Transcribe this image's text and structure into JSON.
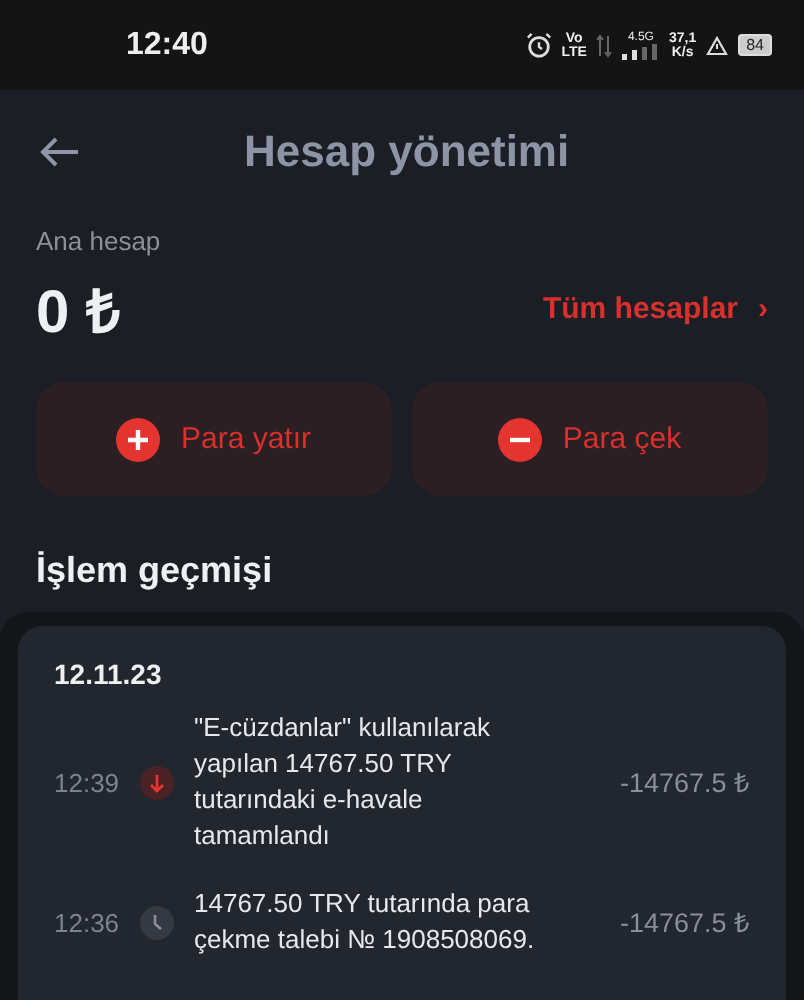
{
  "status_bar": {
    "time": "12:40",
    "volte_top": "Vo",
    "volte_bottom": "LTE",
    "network": "4.5G",
    "speed_value": "37,1",
    "speed_unit": "K/s",
    "battery": "84"
  },
  "header": {
    "title": "Hesap yönetimi"
  },
  "account": {
    "label": "Ana hesap",
    "balance": "0 ₺",
    "all_accounts": "Tüm hesaplar",
    "chevron": "›"
  },
  "actions": [
    {
      "kind": "deposit",
      "label": "Para yatır"
    },
    {
      "kind": "withdraw",
      "label": "Para çek"
    }
  ],
  "history": {
    "title": "İşlem geçmişi",
    "date": "12.11.23",
    "items": [
      {
        "time": "12:39",
        "kind": "completed",
        "text": "\"E-cüzdanlar\" kullanılarak yapılan 14767.50 TRY tutarındaki e-havale tamamlandı",
        "amount": "-14767.5 ₺"
      },
      {
        "time": "12:36",
        "kind": "pending",
        "text": "14767.50 TRY tutarında para çekme talebi № 1908508069.",
        "amount": "-14767.5 ₺"
      }
    ]
  }
}
